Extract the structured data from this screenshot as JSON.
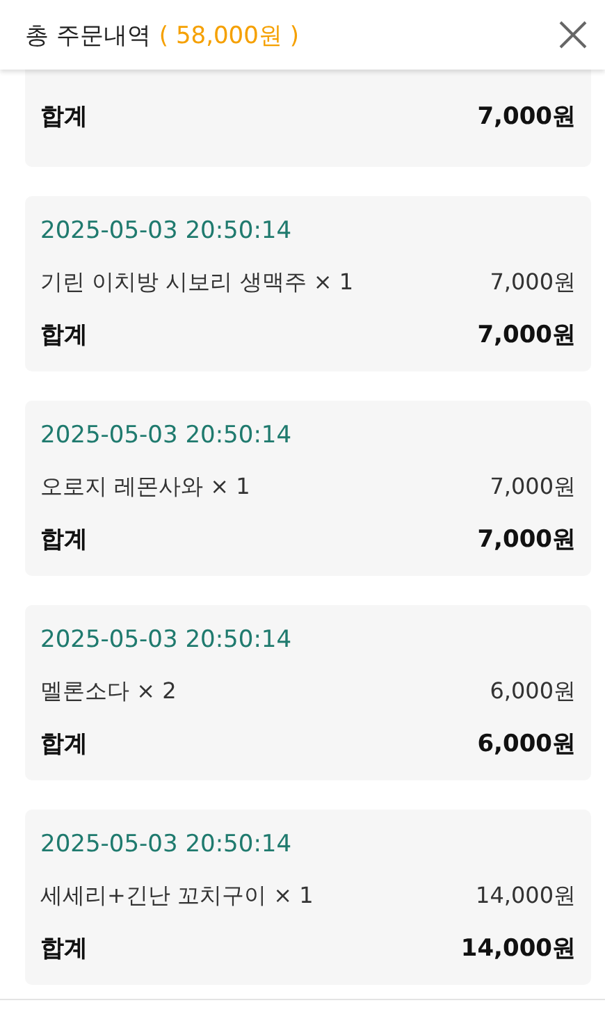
{
  "header": {
    "title": "총 주문내역",
    "total": "( 58,000원 )"
  },
  "orders": [
    {
      "total_label": "합계",
      "total": "7,000원"
    },
    {
      "time": "2025-05-03 20:50:14",
      "items": [
        {
          "name": "기린 이치방 시보리 생맥주 × 1",
          "price": "7,000원"
        }
      ],
      "total_label": "합계",
      "total": "7,000원"
    },
    {
      "time": "2025-05-03 20:50:14",
      "items": [
        {
          "name": "오로지 레몬사와 × 1",
          "price": "7,000원"
        }
      ],
      "total_label": "합계",
      "total": "7,000원"
    },
    {
      "time": "2025-05-03 20:50:14",
      "items": [
        {
          "name": "멜론소다 × 2",
          "price": "6,000원"
        }
      ],
      "total_label": "합계",
      "total": "6,000원"
    },
    {
      "time": "2025-05-03 20:50:14",
      "items": [
        {
          "name": "세세리+긴난 꼬치구이 × 1",
          "price": "14,000원"
        }
      ],
      "total_label": "합계",
      "total": "14,000원"
    }
  ]
}
